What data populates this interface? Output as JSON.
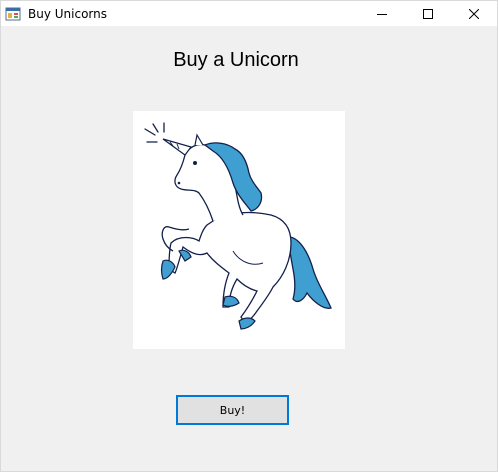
{
  "window": {
    "title": "Buy Unicorns",
    "icon": "app-window-icon",
    "controls": [
      "minimize-icon",
      "maximize-icon",
      "close-icon"
    ]
  },
  "content": {
    "heading": "Buy a Unicorn",
    "image": {
      "name": "unicorn-illustration",
      "colors": {
        "outline": "#13204a",
        "mane": "#3f9fd0",
        "background": "#ffffff"
      }
    },
    "buy_button_label": "Buy!"
  },
  "colors": {
    "window_background": "#f0f0f0",
    "focus_border": "#0078d7",
    "button_face": "#e1e1e1"
  }
}
